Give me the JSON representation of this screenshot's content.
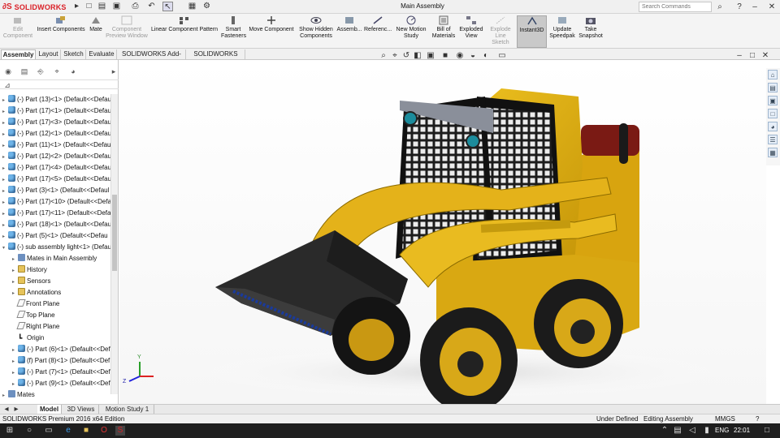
{
  "app": {
    "brand": "SOLIDWORKS",
    "title": "Main Assembly",
    "search_placeholder": "Search Commands",
    "help_label": "?"
  },
  "ribbon": {
    "buttons": [
      {
        "label": "Edit Component",
        "icon": "edit-component-icon",
        "disabled": true
      },
      {
        "label": "Insert Components",
        "icon": "insert-components-icon",
        "disabled": false
      },
      {
        "label": "Mate",
        "icon": "mate-icon",
        "disabled": false
      },
      {
        "label": "Component Preview Window",
        "icon": "preview-window-icon",
        "disabled": true
      },
      {
        "label": "Linear Component Pattern",
        "icon": "pattern-icon",
        "disabled": false
      },
      {
        "label": "Smart Fasteners",
        "icon": "fasteners-icon",
        "disabled": false
      },
      {
        "label": "Move Component",
        "icon": "move-component-icon",
        "disabled": false
      },
      {
        "label": "Show Hidden Components",
        "icon": "show-hidden-icon",
        "disabled": false
      },
      {
        "label": "Assemb...",
        "icon": "assembly-features-icon",
        "disabled": false
      },
      {
        "label": "Referenc...",
        "icon": "reference-geometry-icon",
        "disabled": false
      },
      {
        "label": "New Motion Study",
        "icon": "motion-study-icon",
        "disabled": false
      },
      {
        "label": "Bill of Materials",
        "icon": "bom-icon",
        "disabled": false
      },
      {
        "label": "Exploded View",
        "icon": "exploded-view-icon",
        "disabled": false
      },
      {
        "label": "Explode Line Sketch",
        "icon": "explode-line-icon",
        "disabled": true
      },
      {
        "label": "Instant3D",
        "icon": "instant3d-icon",
        "disabled": false,
        "active": true
      },
      {
        "label": "Update Speedpak",
        "icon": "speedpak-icon",
        "disabled": false
      },
      {
        "label": "Take Snapshot",
        "icon": "snapshot-icon",
        "disabled": false
      }
    ]
  },
  "tabs": [
    "Assembly",
    "Layout",
    "Sketch",
    "Evaluate",
    "SOLIDWORKS Add-Ins",
    "SOLIDWORKS MBD"
  ],
  "tree": {
    "rows": [
      {
        "label": "(-) Part  (13)<1> (Default<<Defau",
        "level": 0,
        "icon": "part"
      },
      {
        "label": "(-) Part  (17)<1> (Default<<Defau",
        "level": 0,
        "icon": "part"
      },
      {
        "label": "(-) Part  (17)<3> (Default<<Defau",
        "level": 0,
        "icon": "part"
      },
      {
        "label": "(-) Part  (12)<1> (Default<<Defau",
        "level": 0,
        "icon": "part"
      },
      {
        "label": "(-) Part  (11)<1> (Default<<Defau",
        "level": 0,
        "icon": "part"
      },
      {
        "label": "(-) Part  (12)<2> (Default<<Defau",
        "level": 0,
        "icon": "part"
      },
      {
        "label": "(-) Part  (17)<4> (Default<<Defau",
        "level": 0,
        "icon": "part"
      },
      {
        "label": "(-) Part  (17)<5> (Default<<Defau",
        "level": 0,
        "icon": "part"
      },
      {
        "label": "(-) Part  (3)<1> (Default<<Defaul",
        "level": 0,
        "icon": "part"
      },
      {
        "label": "(-) Part  (17)<10> (Default<<Defa",
        "level": 0,
        "icon": "part"
      },
      {
        "label": "(-) Part  (17)<11> (Default<<Defa",
        "level": 0,
        "icon": "part"
      },
      {
        "label": "(-) Part  (18)<1> (Default<<Defau",
        "level": 0,
        "icon": "part"
      },
      {
        "label": "(-) Part  (5)<1> (Default<<Defau",
        "level": 0,
        "icon": "part"
      },
      {
        "label": "(-) sub assembly light<1> (Defaul",
        "level": 0,
        "icon": "part",
        "expanded": true
      },
      {
        "label": "Mates in Main Assembly",
        "level": 1,
        "icon": "mates"
      },
      {
        "label": "History",
        "level": 1,
        "icon": "folder"
      },
      {
        "label": "Sensors",
        "level": 1,
        "icon": "folder"
      },
      {
        "label": "Annotations",
        "level": 1,
        "icon": "folder"
      },
      {
        "label": "Front Plane",
        "level": 1,
        "icon": "plane",
        "noarrow": true
      },
      {
        "label": "Top Plane",
        "level": 1,
        "icon": "plane",
        "noarrow": true
      },
      {
        "label": "Right Plane",
        "level": 1,
        "icon": "plane",
        "noarrow": true
      },
      {
        "label": "Origin",
        "level": 1,
        "icon": "origin",
        "noarrow": true
      },
      {
        "label": "(-) Part  (6)<1> (Default<<Def",
        "level": 1,
        "icon": "part"
      },
      {
        "label": "(f) Part  (8)<1> (Default<<Def",
        "level": 1,
        "icon": "part"
      },
      {
        "label": "(-) Part  (7)<1> (Default<<Def",
        "level": 1,
        "icon": "part"
      },
      {
        "label": "(-) Part  (9)<1> (Default<<Def",
        "level": 1,
        "icon": "part"
      },
      {
        "label": "Mates",
        "level": 0,
        "icon": "mates"
      }
    ]
  },
  "bottom_tabs": [
    "Model",
    "3D Views",
    "Motion Study 1"
  ],
  "status": {
    "product": "SOLIDWORKS Premium 2016 x64 Edition",
    "definition": "Under Defined",
    "mode": "Editing Assembly",
    "units": "MMGS",
    "help": "?"
  },
  "taskbar": {
    "lang": "ENG",
    "time": "22:01"
  },
  "colors": {
    "machine_yellow": "#e9b81a",
    "bucket_dark": "#2a2a2a",
    "accent_red": "#da1f26",
    "tire_black": "#1b1b1b"
  }
}
